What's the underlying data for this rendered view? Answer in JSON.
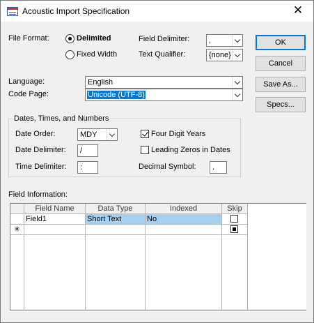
{
  "window": {
    "title": "Acoustic Import Specification",
    "close_glyph": "✕"
  },
  "file_format": {
    "label": "File Format:",
    "delimited_label": "Delimited",
    "fixed_width_label": "Fixed Width",
    "selected": "Delimited"
  },
  "field_delimiter": {
    "label": "Field Delimiter:",
    "value": ","
  },
  "text_qualifier": {
    "label": "Text Qualifier:",
    "value": "{none}"
  },
  "buttons": {
    "ok": "OK",
    "cancel": "Cancel",
    "save_as": "Save As...",
    "specs": "Specs..."
  },
  "language": {
    "label": "Language:",
    "value": "English"
  },
  "code_page": {
    "label": "Code Page:",
    "value": "Unicode (UTF-8)"
  },
  "dates_group": {
    "title": "Dates, Times, and Numbers",
    "date_order_label": "Date Order:",
    "date_order_value": "MDY",
    "date_delimiter_label": "Date Delimiter:",
    "date_delimiter_value": "/",
    "time_delimiter_label": "Time Delimiter:",
    "time_delimiter_value": ":",
    "four_digit_years_label": "Four Digit Years",
    "four_digit_years_checked": true,
    "leading_zeros_label": "Leading Zeros in Dates",
    "leading_zeros_checked": false,
    "decimal_symbol_label": "Decimal Symbol:",
    "decimal_symbol_value": "."
  },
  "field_info": {
    "label": "Field Information:",
    "columns": [
      "Field Name",
      "Data Type",
      "Indexed",
      "Skip"
    ],
    "rows": [
      {
        "field_name": "Field1",
        "data_type": "Short Text",
        "indexed": "No",
        "skip": false
      }
    ],
    "new_row_marker": "✳"
  }
}
